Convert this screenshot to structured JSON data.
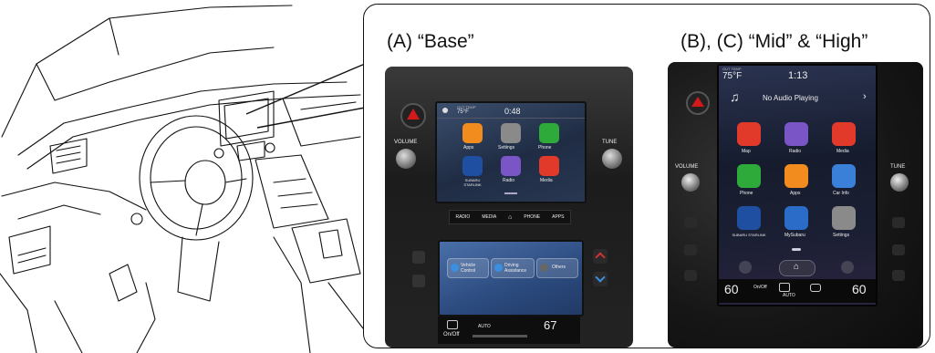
{
  "labels": {
    "base": "(A)  “Base”",
    "mid_high": "(B), (C)  “Mid” & “High”"
  },
  "base_screen": {
    "clock": "0:48",
    "out_temp_label": "OUT TEMP",
    "out_temp": "75°F",
    "apps": [
      "Apps",
      "Settings",
      "Phone",
      "SUBARU STARLINK",
      "Radio",
      "Media"
    ],
    "volume_label": "VOLUME",
    "tune_label": "TUNE",
    "nav_buttons": [
      "RADIO",
      "MEDIA",
      "PHONE",
      "APPS"
    ],
    "lower_buttons": [
      "Vehicle Control",
      "Driving Assistance",
      "Others"
    ],
    "climate_left": "On/Off",
    "climate_mode": "AUTO",
    "climate_temp": "67"
  },
  "mid_screen": {
    "out_temp_label": "OUT TEMP",
    "out_temp": "75°F",
    "clock": "1:13",
    "audio": "No Audio Playing",
    "apps": [
      "Map",
      "Radio",
      "Media",
      "Phone",
      "Apps",
      "Car Info",
      "SUBARU STARLINK",
      "MySubaru",
      "Settings"
    ],
    "volume_label": "VOLUME",
    "tune_label": "TUNE",
    "temp_left": "60",
    "temp_right": "60",
    "climate_left": "On/Off",
    "climate_mode": "AUTO"
  },
  "colors": {
    "apps_orange": "#f28c1e",
    "settings_grey": "#8a8a8a",
    "phone_green": "#2eaa3a",
    "radio_purple": "#7a55c6",
    "media_red": "#e23a2a",
    "starlink_blue": "#1f4fa0",
    "carinfo_blue": "#3a7fd8",
    "mysubaru_blue": "#2b6cc8",
    "hazard_red": "#d21a1a",
    "climate_blue": "#4a8fe0"
  }
}
